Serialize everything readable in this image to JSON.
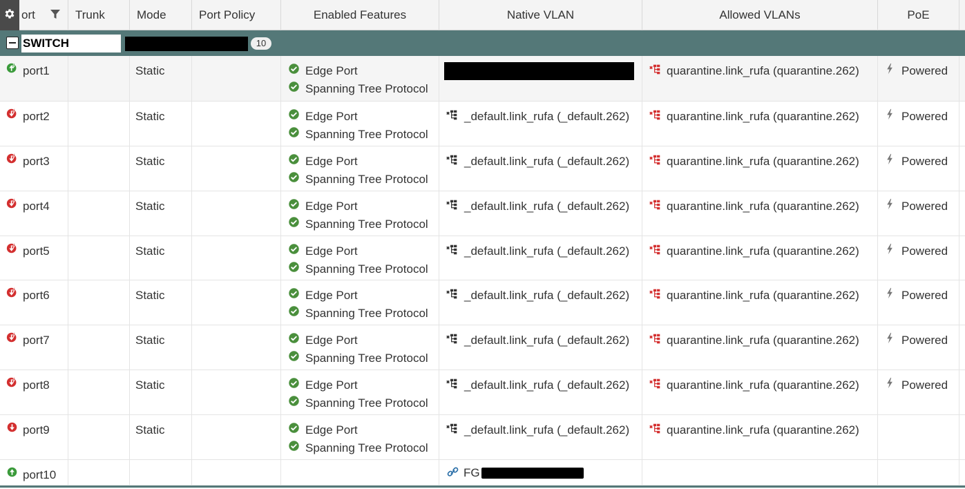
{
  "header": {
    "columns": {
      "port": "ort",
      "trunk": "Trunk",
      "mode": "Mode",
      "port_policy": "Port Policy",
      "enabled_features": "Enabled Features",
      "native_vlan": "Native VLAN",
      "allowed_vlans": "Allowed VLANs",
      "poe": "PoE"
    }
  },
  "group": {
    "label": "SWITCH",
    "count": "10"
  },
  "rows": [
    {
      "port": "port1",
      "status": "up-poe",
      "mode": "Static",
      "features": [
        "Edge Port",
        "Spanning Tree Protocol"
      ],
      "native": "",
      "allowed": "quarantine.link_rufa (quarantine.262)",
      "poe": "Powered"
    },
    {
      "port": "port2",
      "status": "down-poe",
      "mode": "Static",
      "features": [
        "Edge Port",
        "Spanning Tree Protocol"
      ],
      "native": "_default.link_rufa (_default.262)",
      "allowed": "quarantine.link_rufa (quarantine.262)",
      "poe": "Powered"
    },
    {
      "port": "port3",
      "status": "down-poe",
      "mode": "Static",
      "features": [
        "Edge Port",
        "Spanning Tree Protocol"
      ],
      "native": "_default.link_rufa (_default.262)",
      "allowed": "quarantine.link_rufa (quarantine.262)",
      "poe": "Powered"
    },
    {
      "port": "port4",
      "status": "down-poe",
      "mode": "Static",
      "features": [
        "Edge Port",
        "Spanning Tree Protocol"
      ],
      "native": "_default.link_rufa (_default.262)",
      "allowed": "quarantine.link_rufa (quarantine.262)",
      "poe": "Powered"
    },
    {
      "port": "port5",
      "status": "down-poe",
      "mode": "Static",
      "features": [
        "Edge Port",
        "Spanning Tree Protocol"
      ],
      "native": "_default.link_rufa (_default.262)",
      "allowed": "quarantine.link_rufa (quarantine.262)",
      "poe": "Powered"
    },
    {
      "port": "port6",
      "status": "down-poe",
      "mode": "Static",
      "features": [
        "Edge Port",
        "Spanning Tree Protocol"
      ],
      "native": "_default.link_rufa (_default.262)",
      "allowed": "quarantine.link_rufa (quarantine.262)",
      "poe": "Powered"
    },
    {
      "port": "port7",
      "status": "down-poe",
      "mode": "Static",
      "features": [
        "Edge Port",
        "Spanning Tree Protocol"
      ],
      "native": "_default.link_rufa (_default.262)",
      "allowed": "quarantine.link_rufa (quarantine.262)",
      "poe": "Powered"
    },
    {
      "port": "port8",
      "status": "down-poe",
      "mode": "Static",
      "features": [
        "Edge Port",
        "Spanning Tree Protocol"
      ],
      "native": "_default.link_rufa (_default.262)",
      "allowed": "quarantine.link_rufa (quarantine.262)",
      "poe": "Powered"
    },
    {
      "port": "port9",
      "status": "down",
      "mode": "Static",
      "features": [
        "Edge Port",
        "Spanning Tree Protocol"
      ],
      "native": "_default.link_rufa (_default.262)",
      "allowed": "quarantine.link_rufa (quarantine.262)",
      "poe": ""
    },
    {
      "port": "port10",
      "status": "up",
      "mode": "",
      "features": [],
      "native": "FG",
      "allowed": "",
      "poe": ""
    }
  ],
  "colors": {
    "group_bg": "#547878",
    "status_up": "#3a9a3a",
    "status_down": "#d32f2f",
    "feature_check": "#4a8f3c",
    "allowed_icon": "#d32f2f",
    "native_icon": "#333333",
    "link_icon": "#2b6fa8"
  },
  "icons": {
    "gear": "gear-icon",
    "filter": "filter-icon",
    "collapse": "collapse-icon",
    "check": "check-circle-icon",
    "vlan": "vlan-network-icon",
    "poe": "lightning-icon",
    "link": "link-icon"
  }
}
